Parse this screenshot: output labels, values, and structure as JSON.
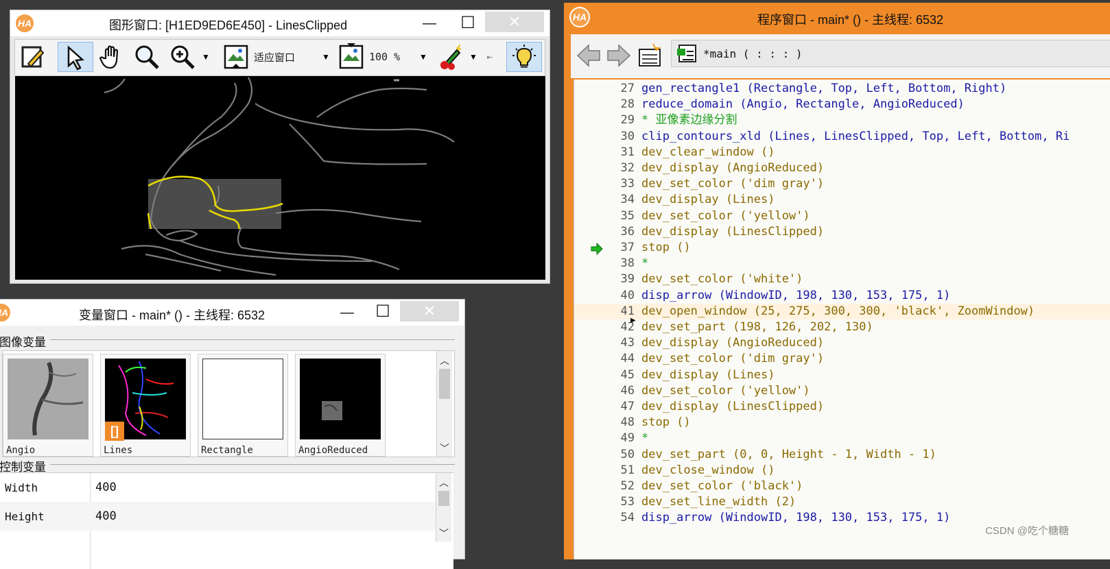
{
  "graphics_window": {
    "title": "图形窗口: [H1ED9ED6E450] - LinesClipped",
    "minimize": "—",
    "maximize": "☐",
    "close": "✕",
    "toolbar": {
      "fit_label": "适应窗口",
      "zoom_label": "100 %"
    }
  },
  "variable_window": {
    "title": "变量窗口 - main* () - 主线程: 6532",
    "minimize": "—",
    "maximize": "☐",
    "close": "✕",
    "image_section": "图像变量",
    "control_section": "控制变量",
    "images": [
      {
        "label": "Angio"
      },
      {
        "label": "Lines"
      },
      {
        "label": "Rectangle"
      },
      {
        "label": "AngioReduced"
      }
    ],
    "controls": [
      {
        "name": "Width",
        "value": "400"
      },
      {
        "name": "Height",
        "value": "400"
      }
    ]
  },
  "program_window": {
    "title": "程序窗口 - main* () - 主线程: 6532",
    "breadcrumb": "*main ( : : : )",
    "lines": [
      {
        "n": "27",
        "text": "gen_rectangle1 (Rectangle, Top, Left, Bottom, Right)",
        "kind": "op"
      },
      {
        "n": "28",
        "text": "reduce_domain (Angio, Rectangle, AngioReduced)",
        "kind": "op"
      },
      {
        "n": "29",
        "text": "* 亚像素边缘分割",
        "kind": "cm"
      },
      {
        "n": "30",
        "text": "clip_contours_xld (Lines, LinesClipped, Top, Left, Bottom, Ri",
        "kind": "op"
      },
      {
        "n": "31",
        "text": "dev_clear_window ()",
        "kind": "ar"
      },
      {
        "n": "32",
        "text": "dev_display (AngioReduced)",
        "kind": "ar"
      },
      {
        "n": "33",
        "text": "dev_set_color ('dim gray')",
        "kind": "ar"
      },
      {
        "n": "34",
        "text": "dev_display (Lines)",
        "kind": "ar"
      },
      {
        "n": "35",
        "text": "dev_set_color ('yellow')",
        "kind": "ar"
      },
      {
        "n": "36",
        "text": "dev_display (LinesClipped)",
        "kind": "ar"
      },
      {
        "n": "37",
        "text": "stop ()",
        "kind": "ar"
      },
      {
        "n": "38",
        "text": "*",
        "kind": "cm"
      },
      {
        "n": "39",
        "text": "dev_set_color ('white')",
        "kind": "ar"
      },
      {
        "n": "40",
        "text": "disp_arrow (WindowID, 198, 130, 153, 175, 1)",
        "kind": "op"
      },
      {
        "n": "41",
        "text": "dev_open_window (25, 275, 300, 300, 'black', ZoomWindow)",
        "kind": "ar"
      },
      {
        "n": "42",
        "text": "dev_set_part (198, 126, 202, 130)",
        "kind": "ar"
      },
      {
        "n": "43",
        "text": "dev_display (AngioReduced)",
        "kind": "ar"
      },
      {
        "n": "44",
        "text": "dev_set_color ('dim gray')",
        "kind": "ar"
      },
      {
        "n": "45",
        "text": "dev_display (Lines)",
        "kind": "ar"
      },
      {
        "n": "46",
        "text": "dev_set_color ('yellow')",
        "kind": "ar"
      },
      {
        "n": "47",
        "text": "dev_display (LinesClipped)",
        "kind": "ar"
      },
      {
        "n": "48",
        "text": "stop ()",
        "kind": "ar"
      },
      {
        "n": "49",
        "text": "*",
        "kind": "cm"
      },
      {
        "n": "50",
        "text": "dev_set_part (0, 0, Height - 1, Width - 1)",
        "kind": "ar"
      },
      {
        "n": "51",
        "text": "dev_close_window ()",
        "kind": "ar"
      },
      {
        "n": "52",
        "text": "dev_set_color ('black')",
        "kind": "ar"
      },
      {
        "n": "53",
        "text": "dev_set_line_width (2)",
        "kind": "ar"
      },
      {
        "n": "54",
        "text": "disp_arrow (WindowID, 198, 130, 153, 175, 1)",
        "kind": "op"
      }
    ],
    "current_line": "37",
    "highlight_line": "41"
  },
  "watermark": "CSDN @吃个糖糖",
  "colors": {
    "accent": "#f08a28",
    "operator": "#1a1aa6",
    "comment": "#1fa01f",
    "argument": "#8a6a00"
  }
}
